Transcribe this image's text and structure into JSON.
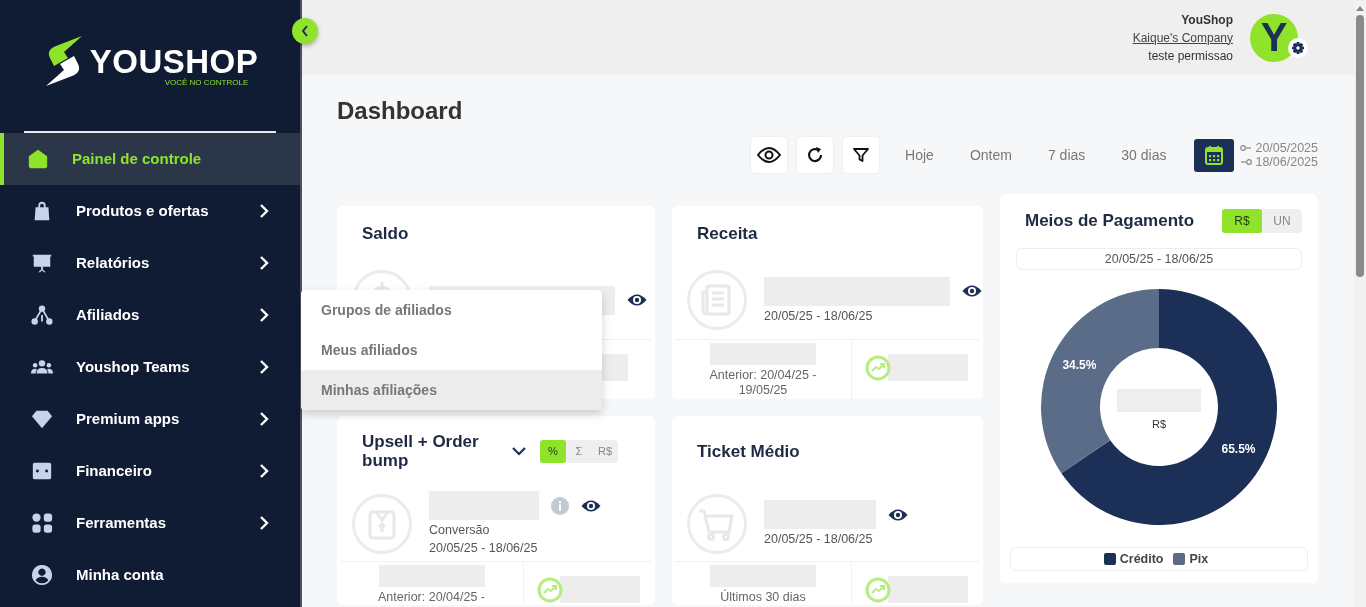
{
  "sidebar": {
    "logo": {
      "name": "YOUSHOP",
      "tagline": "VOCÊ NO CONTROLE"
    },
    "items": [
      {
        "label": "Painel de controle",
        "selected": true,
        "has_submenu": false
      },
      {
        "label": "Produtos e ofertas",
        "selected": false,
        "has_submenu": true
      },
      {
        "label": "Relatórios",
        "selected": false,
        "has_submenu": true
      },
      {
        "label": "Afiliados",
        "selected": false,
        "has_submenu": true
      },
      {
        "label": "Youshop Teams",
        "selected": false,
        "has_submenu": true
      },
      {
        "label": "Premium apps",
        "selected": false,
        "has_submenu": true
      },
      {
        "label": "Financeiro",
        "selected": false,
        "has_submenu": true
      },
      {
        "label": "Ferramentas",
        "selected": false,
        "has_submenu": true
      },
      {
        "label": "Minha conta",
        "selected": false,
        "has_submenu": false
      }
    ]
  },
  "submenu": {
    "items": [
      {
        "label": "Grupos de afiliados",
        "selected": false
      },
      {
        "label": "Meus afiliados",
        "selected": false
      },
      {
        "label": "Minhas afiliações",
        "selected": true
      }
    ]
  },
  "header": {
    "user": {
      "name": "YouShop",
      "company": "Kaique's Company",
      "role": "teste permissao",
      "avatar_letter": "Y"
    }
  },
  "page_title": "Dashboard",
  "toolbar": {
    "ranges": [
      {
        "label": "Hoje"
      },
      {
        "label": "Ontem"
      },
      {
        "label": "7 dias"
      },
      {
        "label": "30 dias"
      }
    ],
    "date_from": "20/05/2025",
    "date_to": "18/06/2025"
  },
  "cards": [
    {
      "kind": "stat",
      "title": "Saldo"
    },
    {
      "kind": "stat",
      "title": "Receita",
      "date": "20/05/25 - 18/06/25",
      "footer_text": "Anterior: 20/04/25 - 19/05/25"
    },
    {
      "kind": "payments",
      "title": "Meios de Pagamento",
      "units": [
        {
          "label": "R$",
          "selected": true
        },
        {
          "label": "UN",
          "selected": false
        }
      ],
      "date": "20/05/25 - 18/06/25",
      "center_label": "R$",
      "legend": [
        {
          "color": "#1b2f57"
        },
        {
          "color": "#5b6c88"
        }
      ],
      "chart_data": {
        "type": "donut",
        "categories": [
          "Crédito",
          "Pix"
        ],
        "values": [
          65.5,
          34.5
        ],
        "value_labels": [
          "65.5%",
          "34.5%"
        ]
      }
    },
    {
      "kind": "stat",
      "title": "Upsell + Order bump",
      "has_info": true,
      "modes": [
        {
          "label": "%",
          "selected": true
        },
        {
          "label": "Σ",
          "selected": false
        },
        {
          "label": "R$",
          "selected": false
        }
      ],
      "subtitle": "Conversão",
      "date": "20/05/25 - 18/06/25",
      "footer_text": "Anterior: 20/04/25 -"
    },
    {
      "kind": "stat",
      "title": "Ticket Médio",
      "date": "20/05/25 - 18/06/25",
      "footer_text": "Últimos 30 dias"
    }
  ]
}
